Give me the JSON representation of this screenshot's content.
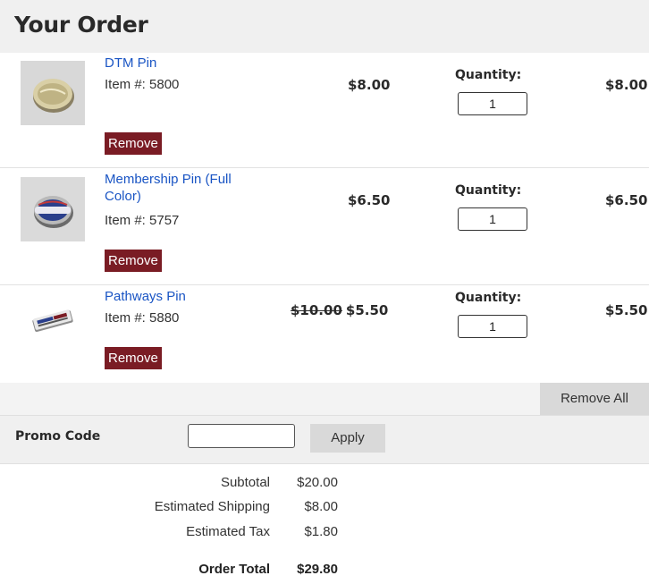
{
  "page_title": "Your Order",
  "items": [
    {
      "name": "DTM Pin",
      "item_number": "Item #: 5800",
      "remove_label": "Remove",
      "price": "$8.00",
      "quantity_label": "Quantity:",
      "quantity": "1",
      "line_total": "$8.00"
    },
    {
      "name_line1": "Membership Pin (Full",
      "name_line2": "Color)",
      "item_number": "Item #: 5757",
      "remove_label": "Remove",
      "price": "$6.50",
      "quantity_label": "Quantity:",
      "quantity": "1",
      "line_total": "$6.50"
    },
    {
      "name": "Pathways Pin",
      "item_number": "Item #: 5880",
      "remove_label": "Remove",
      "original_price": "$10.00",
      "price": "$5.50",
      "quantity_label": "Quantity:",
      "quantity": "1",
      "line_total": "$5.50"
    }
  ],
  "remove_all_label": "Remove All",
  "promo": {
    "label": "Promo Code",
    "value": "",
    "apply_label": "Apply"
  },
  "summary": {
    "subtotal_label": "Subtotal",
    "subtotal": "$20.00",
    "shipping_label": "Estimated Shipping",
    "shipping": "$8.00",
    "tax_label": "Estimated Tax",
    "tax": "$1.80",
    "total_label": "Order Total",
    "total": "$29.80"
  },
  "colors": {
    "link": "#1a55c4",
    "remove_button": "#7a1c24",
    "header_bg": "#f0f0f0",
    "gray_button": "#d9d9d9"
  }
}
